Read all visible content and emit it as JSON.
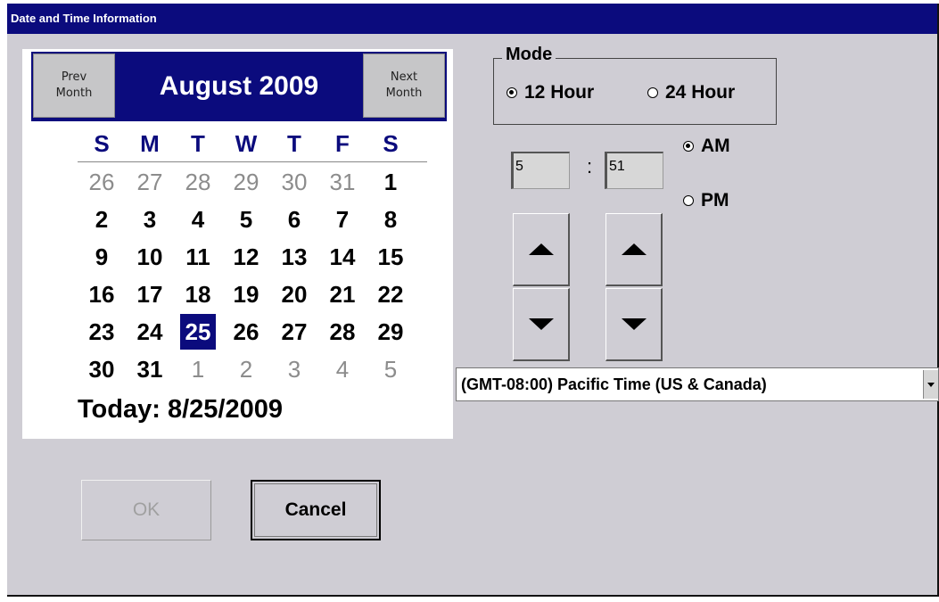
{
  "window": {
    "title": "Date and Time Information"
  },
  "calendar": {
    "prev_label": "Prev\nMonth",
    "next_label": "Next\nMonth",
    "month_title": "August 2009",
    "weekdays": [
      "S",
      "M",
      "T",
      "W",
      "T",
      "F",
      "S"
    ],
    "weeks": [
      [
        {
          "d": "26",
          "o": true
        },
        {
          "d": "27",
          "o": true
        },
        {
          "d": "28",
          "o": true
        },
        {
          "d": "29",
          "o": true
        },
        {
          "d": "30",
          "o": true
        },
        {
          "d": "31",
          "o": true
        },
        {
          "d": "1"
        }
      ],
      [
        {
          "d": "2"
        },
        {
          "d": "3"
        },
        {
          "d": "4"
        },
        {
          "d": "5"
        },
        {
          "d": "6"
        },
        {
          "d": "7"
        },
        {
          "d": "8"
        }
      ],
      [
        {
          "d": "9"
        },
        {
          "d": "10"
        },
        {
          "d": "11"
        },
        {
          "d": "12"
        },
        {
          "d": "13"
        },
        {
          "d": "14"
        },
        {
          "d": "15"
        }
      ],
      [
        {
          "d": "16"
        },
        {
          "d": "17"
        },
        {
          "d": "18"
        },
        {
          "d": "19"
        },
        {
          "d": "20"
        },
        {
          "d": "21"
        },
        {
          "d": "22"
        }
      ],
      [
        {
          "d": "23"
        },
        {
          "d": "24"
        },
        {
          "d": "25",
          "s": true
        },
        {
          "d": "26"
        },
        {
          "d": "27"
        },
        {
          "d": "28"
        },
        {
          "d": "29"
        }
      ],
      [
        {
          "d": "30"
        },
        {
          "d": "31"
        },
        {
          "d": "1",
          "o": true
        },
        {
          "d": "2",
          "o": true
        },
        {
          "d": "3",
          "o": true
        },
        {
          "d": "4",
          "o": true
        },
        {
          "d": "5",
          "o": true
        }
      ]
    ],
    "today_label": "Today: 8/25/2009"
  },
  "mode": {
    "legend": "Mode",
    "options": [
      {
        "label": "12 Hour",
        "selected": true
      },
      {
        "label": "24 Hour",
        "selected": false
      }
    ]
  },
  "time": {
    "hour": "5",
    "separator": ":",
    "minute": "51",
    "ampm": [
      {
        "label": "AM",
        "selected": true
      },
      {
        "label": "PM",
        "selected": false
      }
    ]
  },
  "timezone": {
    "value": "(GMT-08:00) Pacific Time (US & Canada)"
  },
  "buttons": {
    "ok_label": "OK",
    "cancel_label": "Cancel"
  },
  "colors": {
    "title_bg": "#0b0b7d",
    "dialog_bg": "#cfcdd4",
    "selected_day_bg": "#0b0b7d"
  }
}
